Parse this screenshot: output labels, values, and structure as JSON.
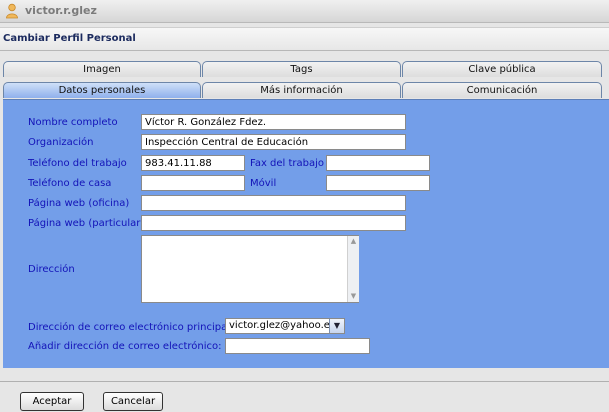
{
  "header": {
    "username": "victor.r.glez"
  },
  "title": "Cambiar Perfil Personal",
  "tabs_row1": [
    {
      "label": "Imagen"
    },
    {
      "label": "Tags"
    },
    {
      "label": "Clave pública"
    }
  ],
  "tabs_row2": [
    {
      "label": "Datos personales",
      "active": true
    },
    {
      "label": "Más información"
    },
    {
      "label": "Comunicación"
    }
  ],
  "form": {
    "nombre_completo": {
      "label": "Nombre completo",
      "value": "Víctor R. González Fdez."
    },
    "organizacion": {
      "label": "Organización",
      "value": "Inspección Central de Educación"
    },
    "telefono_trabajo": {
      "label": "Teléfono del trabajo",
      "value": "983.41.11.88"
    },
    "fax_trabajo": {
      "label": "Fax del trabajo",
      "value": ""
    },
    "telefono_casa": {
      "label": "Teléfono de casa",
      "value": ""
    },
    "movil": {
      "label": "Móvil",
      "value": ""
    },
    "web_oficina": {
      "label": "Página web (oficina)",
      "value": ""
    },
    "web_particular": {
      "label": "Página web (particular)",
      "value": ""
    },
    "direccion": {
      "label": "Dirección",
      "value": ""
    },
    "email_principal": {
      "label": "Dirección de correo electrónico principal:",
      "value": "victor.glez@yahoo.es"
    },
    "email_add": {
      "label": "Añadir dirección de correo electrónico:",
      "value": ""
    }
  },
  "buttons": {
    "accept": "Aceptar",
    "cancel": "Cancelar"
  },
  "colors": {
    "panel": "#739ee9",
    "label": "#1313b8",
    "active_tab": "#8fb0ec"
  }
}
